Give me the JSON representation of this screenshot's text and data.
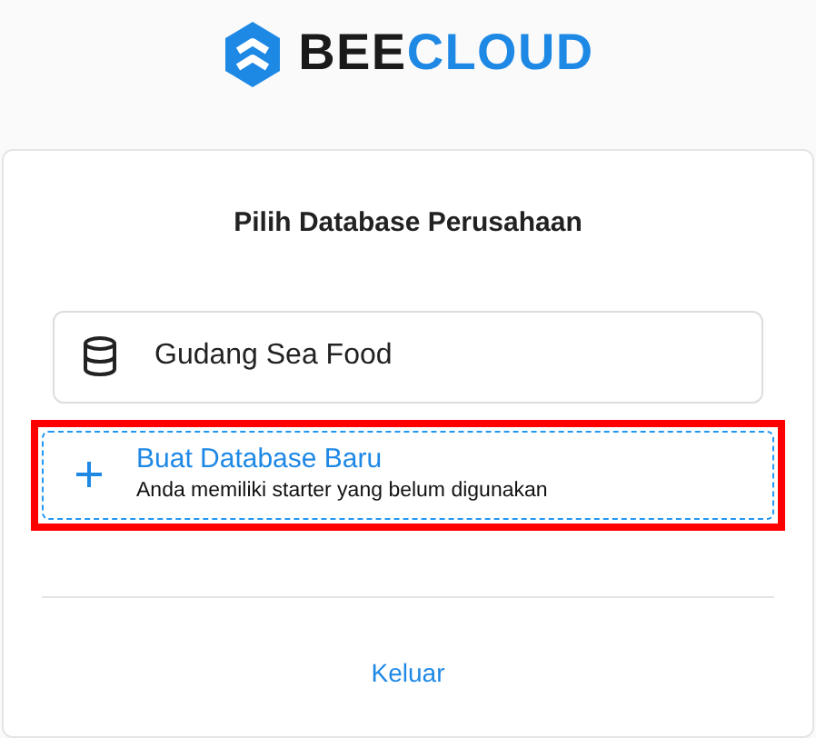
{
  "logo": {
    "part_1": "BEE",
    "part_2": "CLOUD"
  },
  "card": {
    "title": "Pilih Database Perusahaan",
    "databases": [
      {
        "kind": "database",
        "name": "Gudang Sea Food"
      }
    ],
    "create": {
      "title": "Buat Database Baru",
      "subtitle": "Anda memiliki starter yang belum digunakan",
      "highlighted": true
    },
    "logout": "Keluar"
  }
}
